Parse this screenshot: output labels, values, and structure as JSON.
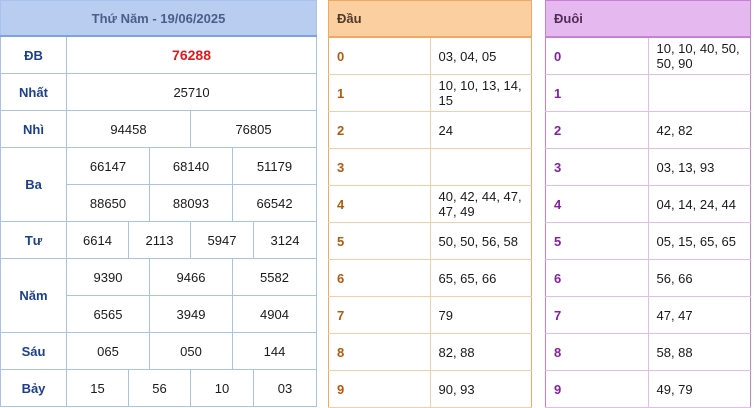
{
  "results": {
    "header": "Thứ Năm - 19/06/2025",
    "prizes": [
      {
        "label": "ĐB",
        "values": [
          "76288"
        ]
      },
      {
        "label": "Nhất",
        "values": [
          "25710"
        ]
      },
      {
        "label": "Nhì",
        "values": [
          "94458",
          "76805"
        ]
      },
      {
        "label": "Ba",
        "values": [
          "66147",
          "68140",
          "51179",
          "88650",
          "88093",
          "66542"
        ]
      },
      {
        "label": "Tư",
        "values": [
          "6614",
          "2113",
          "5947",
          "3124"
        ]
      },
      {
        "label": "Năm",
        "values": [
          "9390",
          "9466",
          "5582",
          "6565",
          "3949",
          "4904"
        ]
      },
      {
        "label": "Sáu",
        "values": [
          "065",
          "050",
          "144"
        ]
      },
      {
        "label": "Bảy",
        "values": [
          "15",
          "56",
          "10",
          "03"
        ]
      }
    ]
  },
  "dau": {
    "header": "Đầu",
    "rows": [
      {
        "key": "0",
        "values": "03, 04, 05"
      },
      {
        "key": "1",
        "values": "10, 10, 13, 14, 15"
      },
      {
        "key": "2",
        "values": "24"
      },
      {
        "key": "3",
        "values": ""
      },
      {
        "key": "4",
        "values": "40, 42, 44, 47, 47, 49"
      },
      {
        "key": "5",
        "values": "50, 50, 56, 58"
      },
      {
        "key": "6",
        "values": "65, 65, 66"
      },
      {
        "key": "7",
        "values": "79"
      },
      {
        "key": "8",
        "values": "82, 88"
      },
      {
        "key": "9",
        "values": "90, 93"
      }
    ]
  },
  "duoi": {
    "header": "Đuôi",
    "rows": [
      {
        "key": "0",
        "values": "10, 10, 40, 50, 50, 90"
      },
      {
        "key": "1",
        "values": ""
      },
      {
        "key": "2",
        "values": "42, 82"
      },
      {
        "key": "3",
        "values": "03, 13, 93"
      },
      {
        "key": "4",
        "values": "04, 14, 24, 44"
      },
      {
        "key": "5",
        "values": "05, 15, 65, 65"
      },
      {
        "key": "6",
        "values": "56, 66"
      },
      {
        "key": "7",
        "values": "47, 47"
      },
      {
        "key": "8",
        "values": "58, 88"
      },
      {
        "key": "9",
        "values": "49, 79"
      }
    ]
  },
  "colors": {
    "special_prize": "#e0191f",
    "results_header": "#b9cdf0",
    "dau_header": "#fbcf9f",
    "duoi_header": "#e6b8f0"
  }
}
